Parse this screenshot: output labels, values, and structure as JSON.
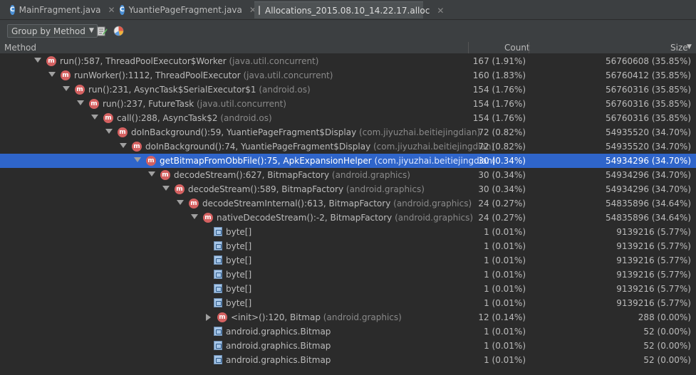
{
  "tabs": [
    {
      "label": "MainFragment.java",
      "icon": "java-class-icon",
      "active": false
    },
    {
      "label": "YuantiePageFragment.java",
      "icon": "java-class-icon",
      "active": false
    },
    {
      "label": "Allocations_2015.08.10_14.22.17.alloc",
      "icon": "alloc-file-icon",
      "active": true
    }
  ],
  "toolbar": {
    "group_by_label": "Group by Method",
    "group_by_arrow": "▼"
  },
  "columns": {
    "method": "Method",
    "count": "Count",
    "size": "Size",
    "sort_indicator": "▼"
  },
  "rows": [
    {
      "level": 0,
      "expand": "down",
      "icon": "method",
      "text": "run():587, ThreadPoolExecutor$Worker",
      "pkg": "(java.util.concurrent)",
      "count": "167 (1.91%)",
      "size": "56760608 (35.85%)"
    },
    {
      "level": 1,
      "expand": "down",
      "icon": "method",
      "text": "runWorker():1112, ThreadPoolExecutor",
      "pkg": "(java.util.concurrent)",
      "count": "160 (1.83%)",
      "size": "56760412 (35.85%)"
    },
    {
      "level": 2,
      "expand": "down",
      "icon": "method",
      "text": "run():231, AsyncTask$SerialExecutor$1",
      "pkg": "(android.os)",
      "count": "154 (1.76%)",
      "size": "56760316 (35.85%)"
    },
    {
      "level": 3,
      "expand": "down",
      "icon": "method",
      "text": "run():237, FutureTask",
      "pkg": "(java.util.concurrent)",
      "count": "154 (1.76%)",
      "size": "56760316 (35.85%)"
    },
    {
      "level": 4,
      "expand": "down",
      "icon": "method",
      "text": "call():288, AsyncTask$2",
      "pkg": "(android.os)",
      "count": "154 (1.76%)",
      "size": "56760316 (35.85%)"
    },
    {
      "level": 5,
      "expand": "down",
      "icon": "method",
      "text": "doInBackground():59, YuantiePageFragment$Display",
      "pkg": "(com.jiyuzhai.beitiejingdian)",
      "count": "72 (0.82%)",
      "size": "54935520 (34.70%)"
    },
    {
      "level": 6,
      "expand": "down",
      "icon": "method",
      "text": "doInBackground():74, YuantiePageFragment$Display",
      "pkg": "(com.jiyuzhai.beitiejingdian)",
      "count": "72 (0.82%)",
      "size": "54935520 (34.70%)"
    },
    {
      "level": 7,
      "expand": "down",
      "icon": "method",
      "text": "getBitmapFromObbFile():75, ApkExpansionHelper",
      "pkg": "(com.jiyuzhai.beitiejingdian)",
      "count": "30 (0.34%)",
      "size": "54934296 (34.70%)",
      "selected": true
    },
    {
      "level": 8,
      "expand": "down",
      "icon": "method",
      "text": "decodeStream():627, BitmapFactory",
      "pkg": "(android.graphics)",
      "count": "30 (0.34%)",
      "size": "54934296 (34.70%)"
    },
    {
      "level": 9,
      "expand": "down",
      "icon": "method",
      "text": "decodeStream():589, BitmapFactory",
      "pkg": "(android.graphics)",
      "count": "30 (0.34%)",
      "size": "54934296 (34.70%)"
    },
    {
      "level": 10,
      "expand": "down",
      "icon": "method",
      "text": "decodeStreamInternal():613, BitmapFactory",
      "pkg": "(android.graphics)",
      "count": "24 (0.27%)",
      "size": "54835896 (34.64%)"
    },
    {
      "level": 11,
      "expand": "down",
      "icon": "method",
      "text": "nativeDecodeStream():-2, BitmapFactory",
      "pkg": "(android.graphics)",
      "count": "24 (0.27%)",
      "size": "54835896 (34.64%)"
    },
    {
      "level": 12,
      "expand": "none",
      "icon": "class",
      "text": "byte[]",
      "pkg": "",
      "count": "1 (0.01%)",
      "size": "9139216 (5.77%)"
    },
    {
      "level": 12,
      "expand": "none",
      "icon": "class",
      "text": "byte[]",
      "pkg": "",
      "count": "1 (0.01%)",
      "size": "9139216 (5.77%)"
    },
    {
      "level": 12,
      "expand": "none",
      "icon": "class",
      "text": "byte[]",
      "pkg": "",
      "count": "1 (0.01%)",
      "size": "9139216 (5.77%)"
    },
    {
      "level": 12,
      "expand": "none",
      "icon": "class",
      "text": "byte[]",
      "pkg": "",
      "count": "1 (0.01%)",
      "size": "9139216 (5.77%)"
    },
    {
      "level": 12,
      "expand": "none",
      "icon": "class",
      "text": "byte[]",
      "pkg": "",
      "count": "1 (0.01%)",
      "size": "9139216 (5.77%)"
    },
    {
      "level": 12,
      "expand": "none",
      "icon": "class",
      "text": "byte[]",
      "pkg": "",
      "count": "1 (0.01%)",
      "size": "9139216 (5.77%)"
    },
    {
      "level": 12,
      "expand": "right",
      "icon": "method",
      "text": "<init>():120, Bitmap",
      "pkg": "(android.graphics)",
      "count": "12 (0.14%)",
      "size": "288 (0.00%)"
    },
    {
      "level": 12,
      "expand": "none",
      "icon": "class",
      "text": "android.graphics.Bitmap",
      "pkg": "",
      "count": "1 (0.01%)",
      "size": "52 (0.00%)"
    },
    {
      "level": 12,
      "expand": "none",
      "icon": "class",
      "text": "android.graphics.Bitmap",
      "pkg": "",
      "count": "1 (0.01%)",
      "size": "52 (0.00%)"
    },
    {
      "level": 12,
      "expand": "none",
      "icon": "class",
      "text": "android.graphics.Bitmap",
      "pkg": "",
      "count": "1 (0.01%)",
      "size": "52 (0.00%)"
    }
  ]
}
